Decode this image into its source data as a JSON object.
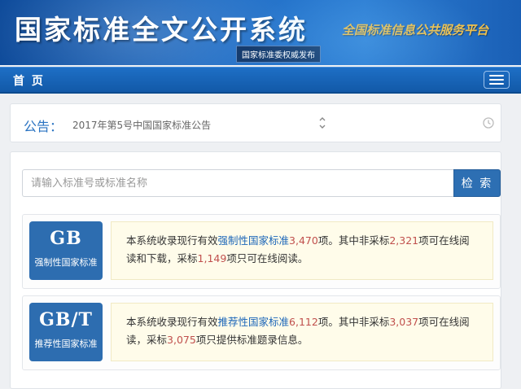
{
  "header": {
    "title": "国家标准全文公开系统",
    "slogan": "全国标准信息公共服务平台",
    "authority": "国家标准委权威发布"
  },
  "nav": {
    "home_label": "首 页",
    "menu_icon": "hamburger-icon"
  },
  "notice": {
    "label": "公告：",
    "text": "2017年第5号中国国家标准公告",
    "icons": [
      "up-down-chevron-icon",
      "clock-icon"
    ]
  },
  "search": {
    "placeholder": "请输入标准号或标准名称",
    "value": "",
    "button_label": "检 索"
  },
  "standards": [
    {
      "code": "GB",
      "name": "强制性国家标准",
      "desc_prefix": "本系统收录现行有效",
      "link_text": "强制性国家标准",
      "total": "3,470",
      "mid1": "项。其中非采标",
      "count_a": "2,321",
      "mid2": "项可在线阅读和下载，采标",
      "count_b": "1,149",
      "suffix": "项只可在线阅读。"
    },
    {
      "code": "GB/T",
      "name": "推荐性国家标准",
      "desc_prefix": "本系统收录现行有效",
      "link_text": "推荐性国家标准",
      "total": "6,112",
      "mid1": "项。其中非采标",
      "count_a": "3,037",
      "mid2": "项可在线阅读，采标",
      "count_b": "3,075",
      "suffix": "项只提供标准题录信息。"
    }
  ],
  "colors": {
    "brand_blue": "#2d6fb3",
    "link": "#1c66b8",
    "number": "#c0504d",
    "notice_label": "#2a73c2",
    "slogan_gold": "#f2c14b"
  }
}
